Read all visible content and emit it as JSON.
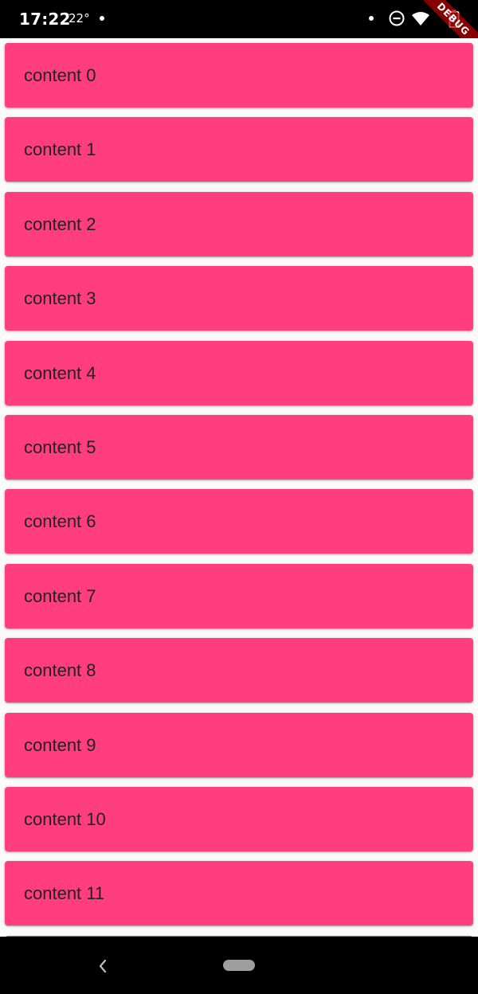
{
  "status_bar": {
    "time": "17:22",
    "temperature": "22°",
    "icons": [
      "notification-dot-icon",
      "do-not-disturb-icon",
      "wifi-icon",
      "battery-icon"
    ],
    "debug_banner": "DEBUG"
  },
  "list": {
    "card_color": "#ff3d7f",
    "items": [
      {
        "label": "content 0"
      },
      {
        "label": "content 1"
      },
      {
        "label": "content 2"
      },
      {
        "label": "content 3"
      },
      {
        "label": "content 4"
      },
      {
        "label": "content 5"
      },
      {
        "label": "content 6"
      },
      {
        "label": "content 7"
      },
      {
        "label": "content 8"
      },
      {
        "label": "content 9"
      },
      {
        "label": "content 10"
      },
      {
        "label": "content 11"
      },
      {
        "label": ""
      }
    ]
  },
  "nav_bar": {
    "icons": [
      "back-icon",
      "home-pill-icon"
    ]
  }
}
